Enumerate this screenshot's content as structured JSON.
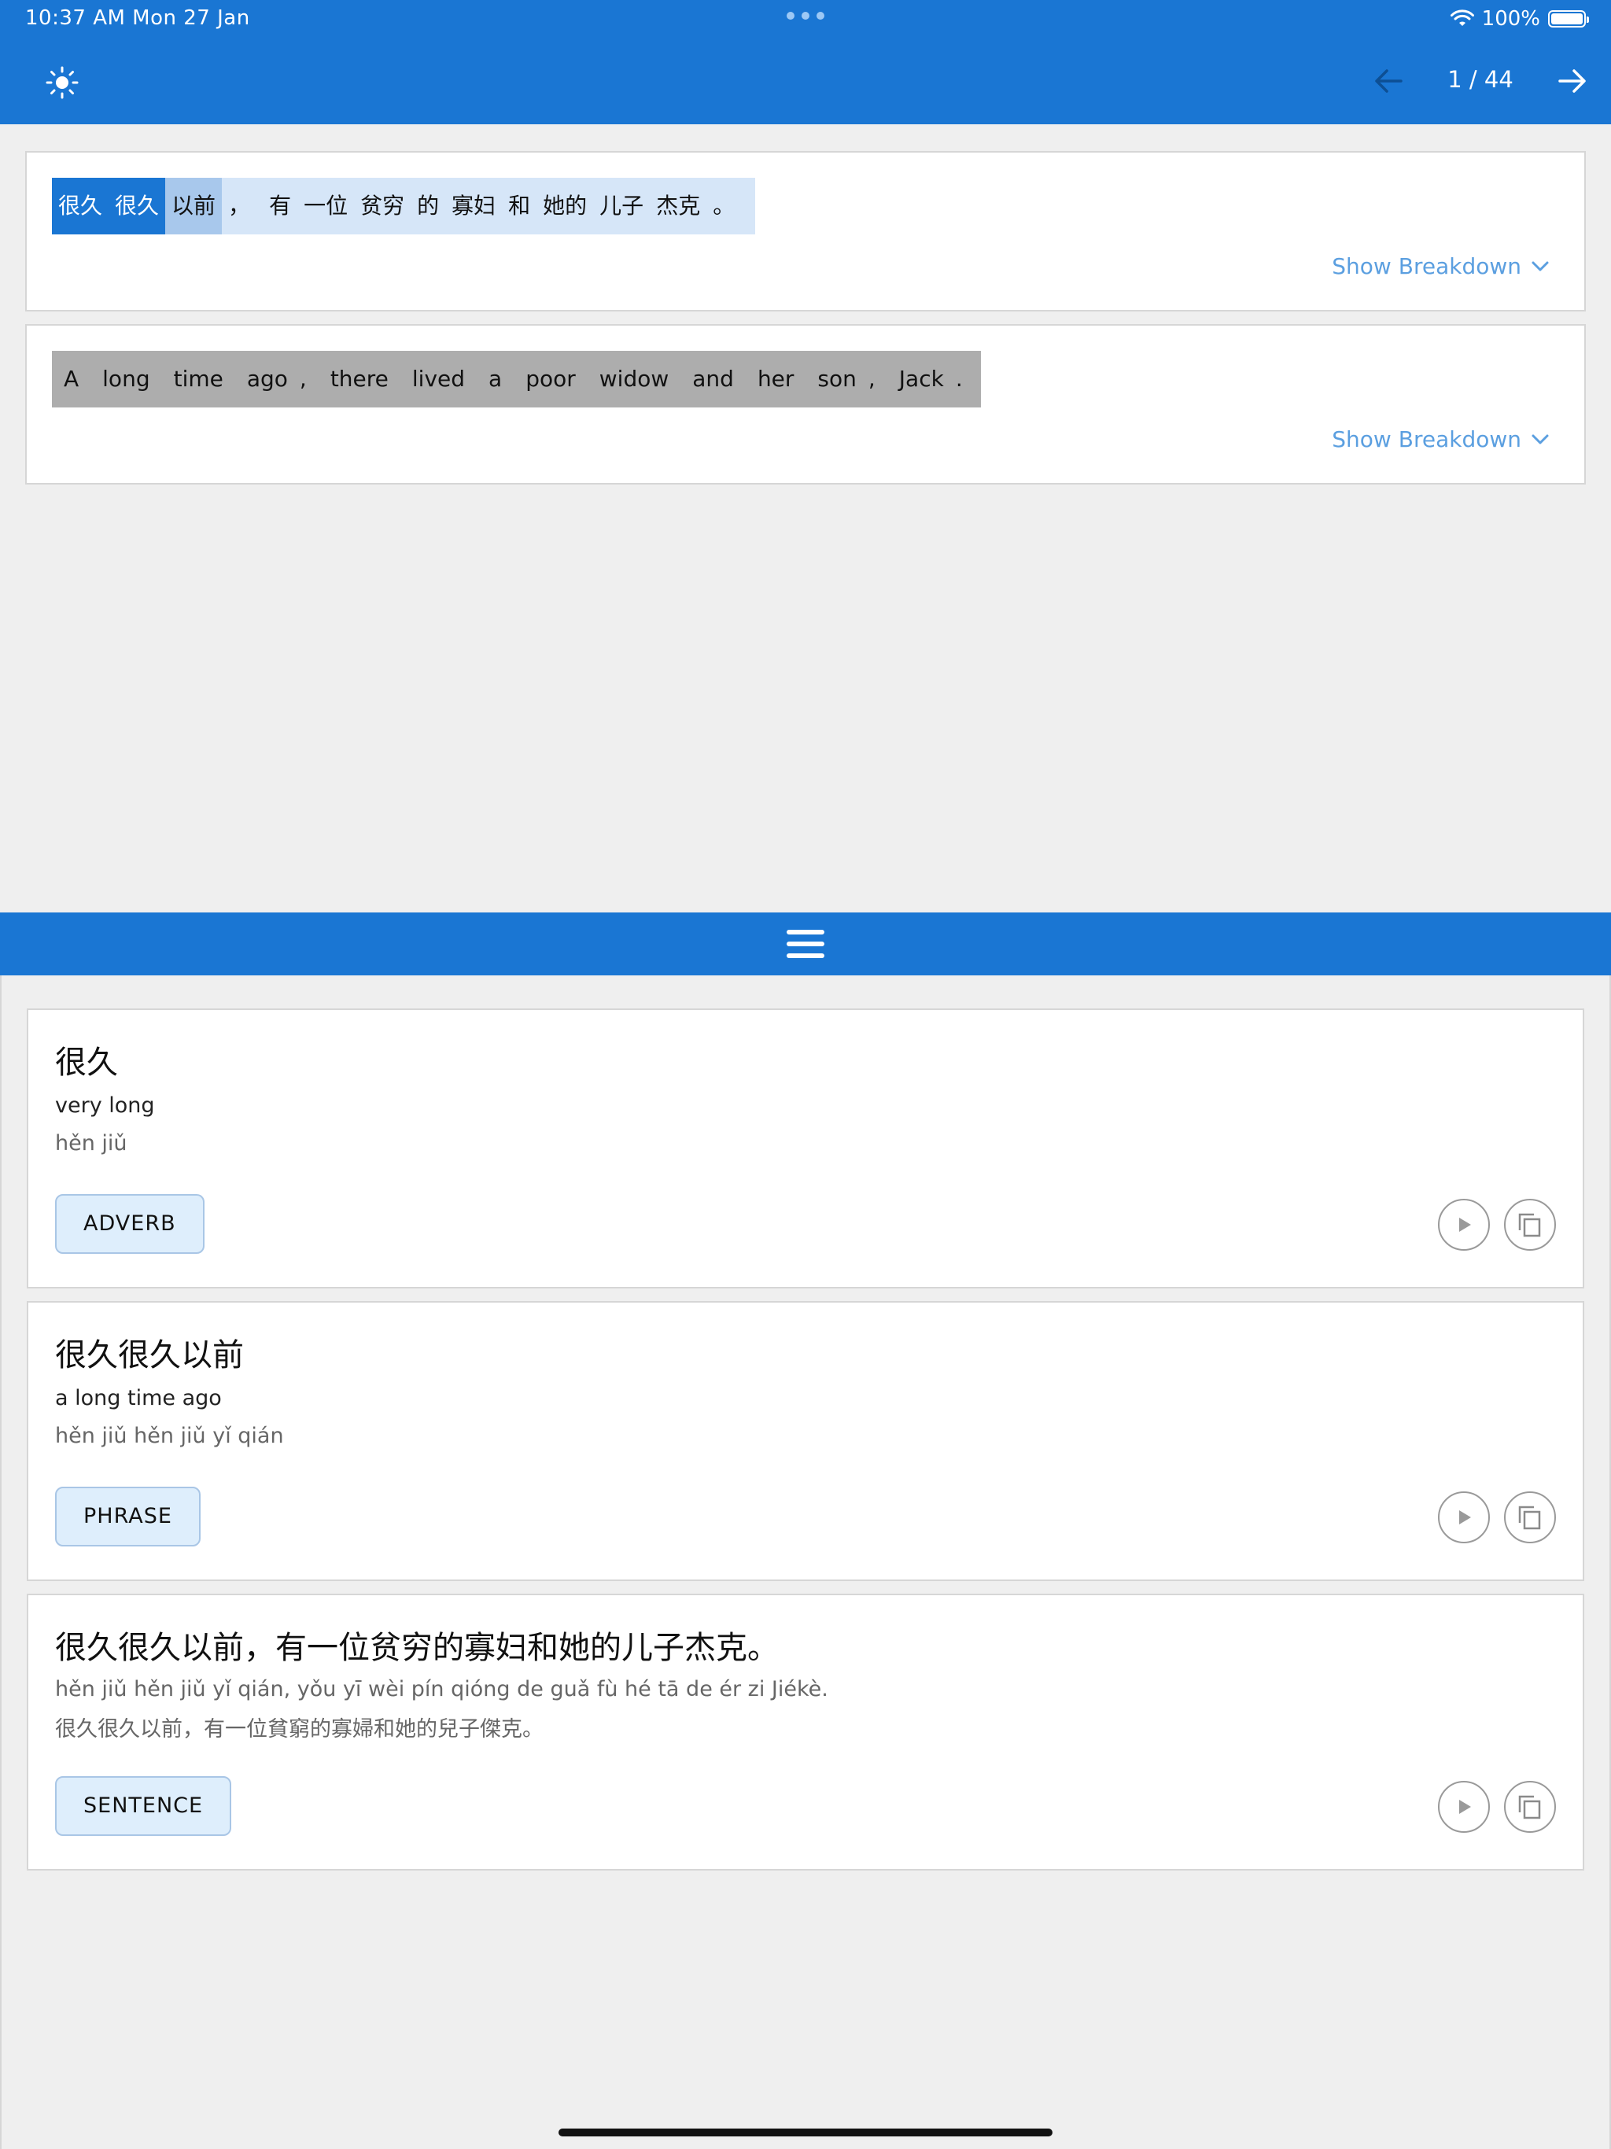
{
  "status_bar": {
    "time_date": "10:37 AM   Mon 27 Jan",
    "battery": "100%"
  },
  "header": {
    "page_counter": "1 / 44"
  },
  "sentence_cards": [
    {
      "tokens": [
        "很久",
        "很久",
        "以前",
        "，",
        "有",
        "一位",
        "贫穷",
        "的",
        "寡妇",
        "和",
        "她的",
        "儿子",
        "杰克",
        "。"
      ],
      "breakdown_label": "Show Breakdown"
    },
    {
      "tokens": [
        "A",
        "long",
        "time",
        "ago",
        ",",
        "there",
        "lived",
        "a",
        "poor",
        "widow",
        "and",
        "her",
        "son",
        ",",
        "Jack",
        "."
      ],
      "breakdown_label": "Show Breakdown"
    }
  ],
  "word_cards": [
    {
      "title": "很久",
      "line1": "very long",
      "line2": "hěn jiǔ",
      "tag": "ADVERB"
    },
    {
      "title": "很久很久以前",
      "line1": "a long time ago",
      "line2": "hěn jiǔ hěn jiǔ yǐ qián",
      "tag": "PHRASE"
    },
    {
      "title": "很久很久以前，有一位贫穷的寡妇和她的儿子杰克。",
      "line1": "hěn jiǔ hěn jiǔ yǐ qián, yǒu yī wèi pín qióng de guǎ fù hé tā de ér zi Jiékè.",
      "line2": "很久很久以前，有一位貧窮的寡婦和她的兒子傑克。",
      "tag": "SENTENCE"
    }
  ],
  "icons": {
    "theme": "sun-icon",
    "prev": "arrow-left-icon",
    "next": "arrow-right-icon",
    "expand": "chevron-down-icon",
    "resize": "hamburger-icon",
    "play": "play-icon",
    "copy": "copy-icon"
  },
  "colors": {
    "primary": "#1a76d3",
    "token_selected": "#1a76d3",
    "token_secondary": "#a8c8ec",
    "token_row_bg": "#d6e6f8",
    "english_row_bg": "#adadad",
    "link": "#5b9fe0",
    "chip_bg": "#deeefc"
  }
}
